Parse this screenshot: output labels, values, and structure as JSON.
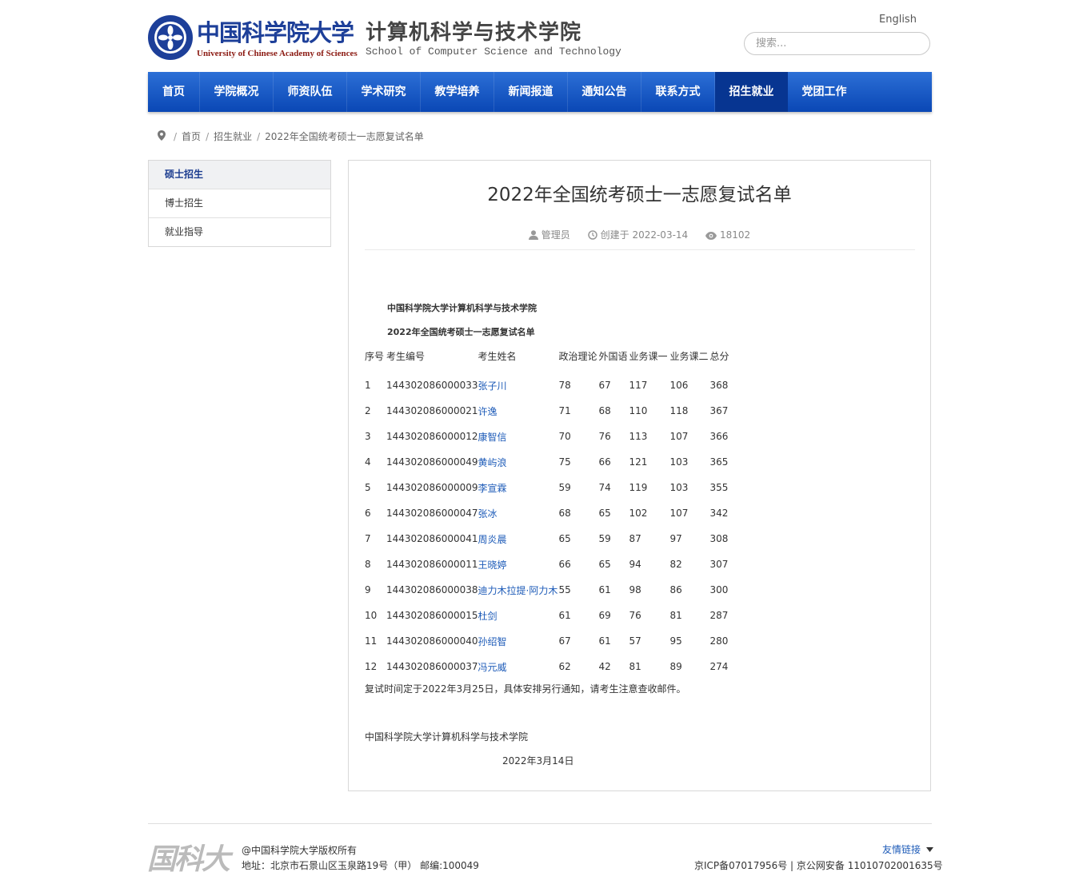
{
  "header": {
    "logo_cn": "中国科学院大学",
    "logo_en": "University of Chinese Academy of Sciences",
    "dept_cn": "计算机科学与技术学院",
    "dept_en": "School of Computer Science and Technology",
    "english_link": "English",
    "search_placeholder": "搜索..."
  },
  "nav": [
    {
      "label": "首页"
    },
    {
      "label": "学院概况"
    },
    {
      "label": "师资队伍"
    },
    {
      "label": "学术研究"
    },
    {
      "label": "教学培养"
    },
    {
      "label": "新闻报道"
    },
    {
      "label": "通知公告"
    },
    {
      "label": "联系方式"
    },
    {
      "label": "招生就业"
    },
    {
      "label": "党团工作"
    }
  ],
  "breadcrumb": {
    "home": "首页",
    "section": "招生就业",
    "current": "2022年全国统考硕士一志愿复试名单"
  },
  "sidebar": {
    "items": [
      {
        "label": "硕士招生"
      },
      {
        "label": "博士招生"
      },
      {
        "label": "就业指导"
      }
    ]
  },
  "article": {
    "title": "2022年全国统考硕士一志愿复试名单",
    "author": "管理员",
    "created": "创建于 2022-03-14",
    "views": "18102",
    "school_heading": "中国科学院大学计算机科学与技术学院",
    "list_heading": "2022年全国统考硕士一志愿复试名单",
    "table": {
      "headers": [
        "序号",
        "考生编号",
        "考生姓名",
        "政治理论",
        "外国语",
        "业务课一",
        "业务课二",
        "总分"
      ],
      "rows": [
        [
          "1",
          "144302086000033",
          "张子川",
          "78",
          "67",
          "117",
          "106",
          "368"
        ],
        [
          "2",
          "144302086000021",
          "许逸",
          "71",
          "68",
          "110",
          "118",
          "367"
        ],
        [
          "3",
          "144302086000012",
          "康智信",
          "70",
          "76",
          "113",
          "107",
          "366"
        ],
        [
          "4",
          "144302086000049",
          "黄屿浪",
          "75",
          "66",
          "121",
          "103",
          "365"
        ],
        [
          "5",
          "144302086000009",
          "李宣霖",
          "59",
          "74",
          "119",
          "103",
          "355"
        ],
        [
          "6",
          "144302086000047",
          "张冰",
          "68",
          "65",
          "102",
          "107",
          "342"
        ],
        [
          "7",
          "144302086000041",
          "周炎晨",
          "65",
          "59",
          "87",
          "97",
          "308"
        ],
        [
          "8",
          "144302086000011",
          "王晓婷",
          "66",
          "65",
          "94",
          "82",
          "307"
        ],
        [
          "9",
          "144302086000038",
          "迪力木拉提·阿力木",
          "55",
          "61",
          "98",
          "86",
          "300"
        ],
        [
          "10",
          "144302086000015",
          "杜剑",
          "61",
          "69",
          "76",
          "81",
          "287"
        ],
        [
          "11",
          "144302086000040",
          "孙绍智",
          "67",
          "61",
          "57",
          "95",
          "280"
        ],
        [
          "12",
          "144302086000037",
          "冯元威",
          "62",
          "42",
          "81",
          "89",
          "274"
        ]
      ]
    },
    "notice": "复试时间定于2022年3月25日，具体安排另行通知，请考生注意查收邮件。",
    "footer_school": "中国科学院大学计算机科学与技术学院",
    "footer_date": "2022年3月14日"
  },
  "footer": {
    "logo_text": "国科大",
    "copyright": "@中国科学院大学版权所有",
    "address": "地址：北京市石景山区玉泉路19号（甲） 邮编:100049",
    "friend_links": "友情链接",
    "icp": "京ICP备07017956号 | 京公网安备 11010702001635号"
  },
  "colors": {
    "nav_gradient_top": "#2c6fd6",
    "nav_gradient_bottom": "#0a47b5",
    "nav_active": "#073591",
    "link_blue": "#1d5bb8"
  }
}
